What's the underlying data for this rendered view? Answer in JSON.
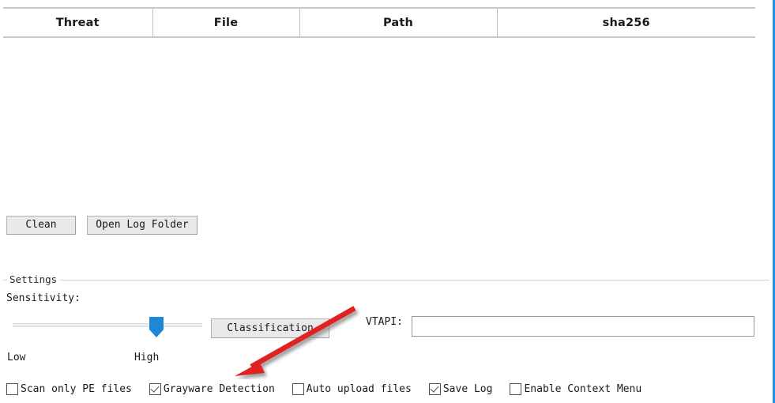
{
  "table": {
    "columns": [
      {
        "key": "threat",
        "label": "Threat"
      },
      {
        "key": "file",
        "label": "File"
      },
      {
        "key": "path",
        "label": "Path"
      },
      {
        "key": "sha256",
        "label": "sha256"
      }
    ],
    "rows": []
  },
  "toolbar": {
    "clean_label": "Clean",
    "open_log_folder_label": "Open Log Folder"
  },
  "settings": {
    "legend": "Settings",
    "sensitivity_label": "Sensitivity:",
    "slider": {
      "low_label": "Low",
      "high_label": "High",
      "value_percent": 78,
      "thumb_color": "#1e88d4",
      "track_color": "#eceff1"
    },
    "classification_label": "Classification",
    "vtapi_label": "VTAPI:",
    "vtapi_value": "",
    "vtapi_placeholder": "",
    "checkboxes": [
      {
        "label": "Scan only PE files",
        "checked": false
      },
      {
        "label": "Grayware Detection",
        "checked": true
      },
      {
        "label": "Auto upload files",
        "checked": false
      },
      {
        "label": "Save Log",
        "checked": true
      },
      {
        "label": "Enable Context Menu",
        "checked": false
      }
    ]
  },
  "annotation": {
    "arrow_color": "#e02020",
    "shadow_color": "#9a9a9a"
  },
  "chrome": {
    "right_edge_color": "#1e90e0"
  }
}
